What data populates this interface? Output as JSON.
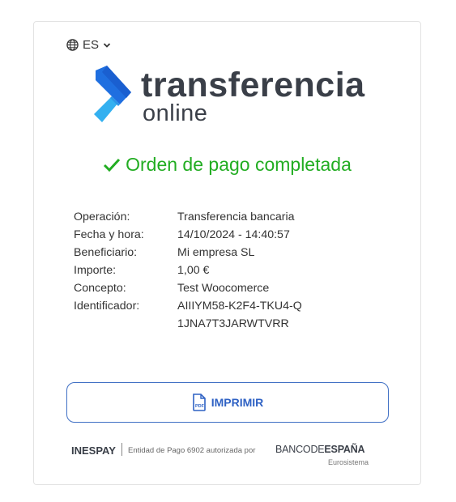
{
  "language": {
    "selected": "ES",
    "icon": "globe-icon",
    "caret": "chevron-down-icon"
  },
  "logo": {
    "line1": "transferencia",
    "line2": "online",
    "colors": {
      "primary": "#1f6fe0",
      "light": "#33b0f0",
      "text": "#3a3f48"
    }
  },
  "status": {
    "text": "Orden de pago completada",
    "icon": "check-icon",
    "color": "#22ad22"
  },
  "details": [
    {
      "label": "Operación:",
      "value": "Transferencia bancaria"
    },
    {
      "label": "Fecha y hora:",
      "value": "14/10/2024 - 14:40:57"
    },
    {
      "label": "Beneficiario:",
      "value": "Mi empresa SL"
    },
    {
      "label": "Importe:",
      "value": "1,00 €"
    },
    {
      "label": "Concepto:",
      "value": "Test Woocomerce"
    },
    {
      "label": "Identificador:",
      "value": "AIIIYM58-K2F4-TKU4-Q1JNA7T3JARWTVRR"
    }
  ],
  "print_button": {
    "label": "IMPRIMIR",
    "icon": "pdf-icon",
    "color": "#2f62c4"
  },
  "footer": {
    "brand": "INESPAY",
    "authorization": "Entidad de Pago 6902 autorizada por",
    "bank_part1": "BANCO",
    "bank_part2": "DE",
    "bank_part3": "ESPAÑA",
    "eurosystem": "Eurosistema"
  }
}
